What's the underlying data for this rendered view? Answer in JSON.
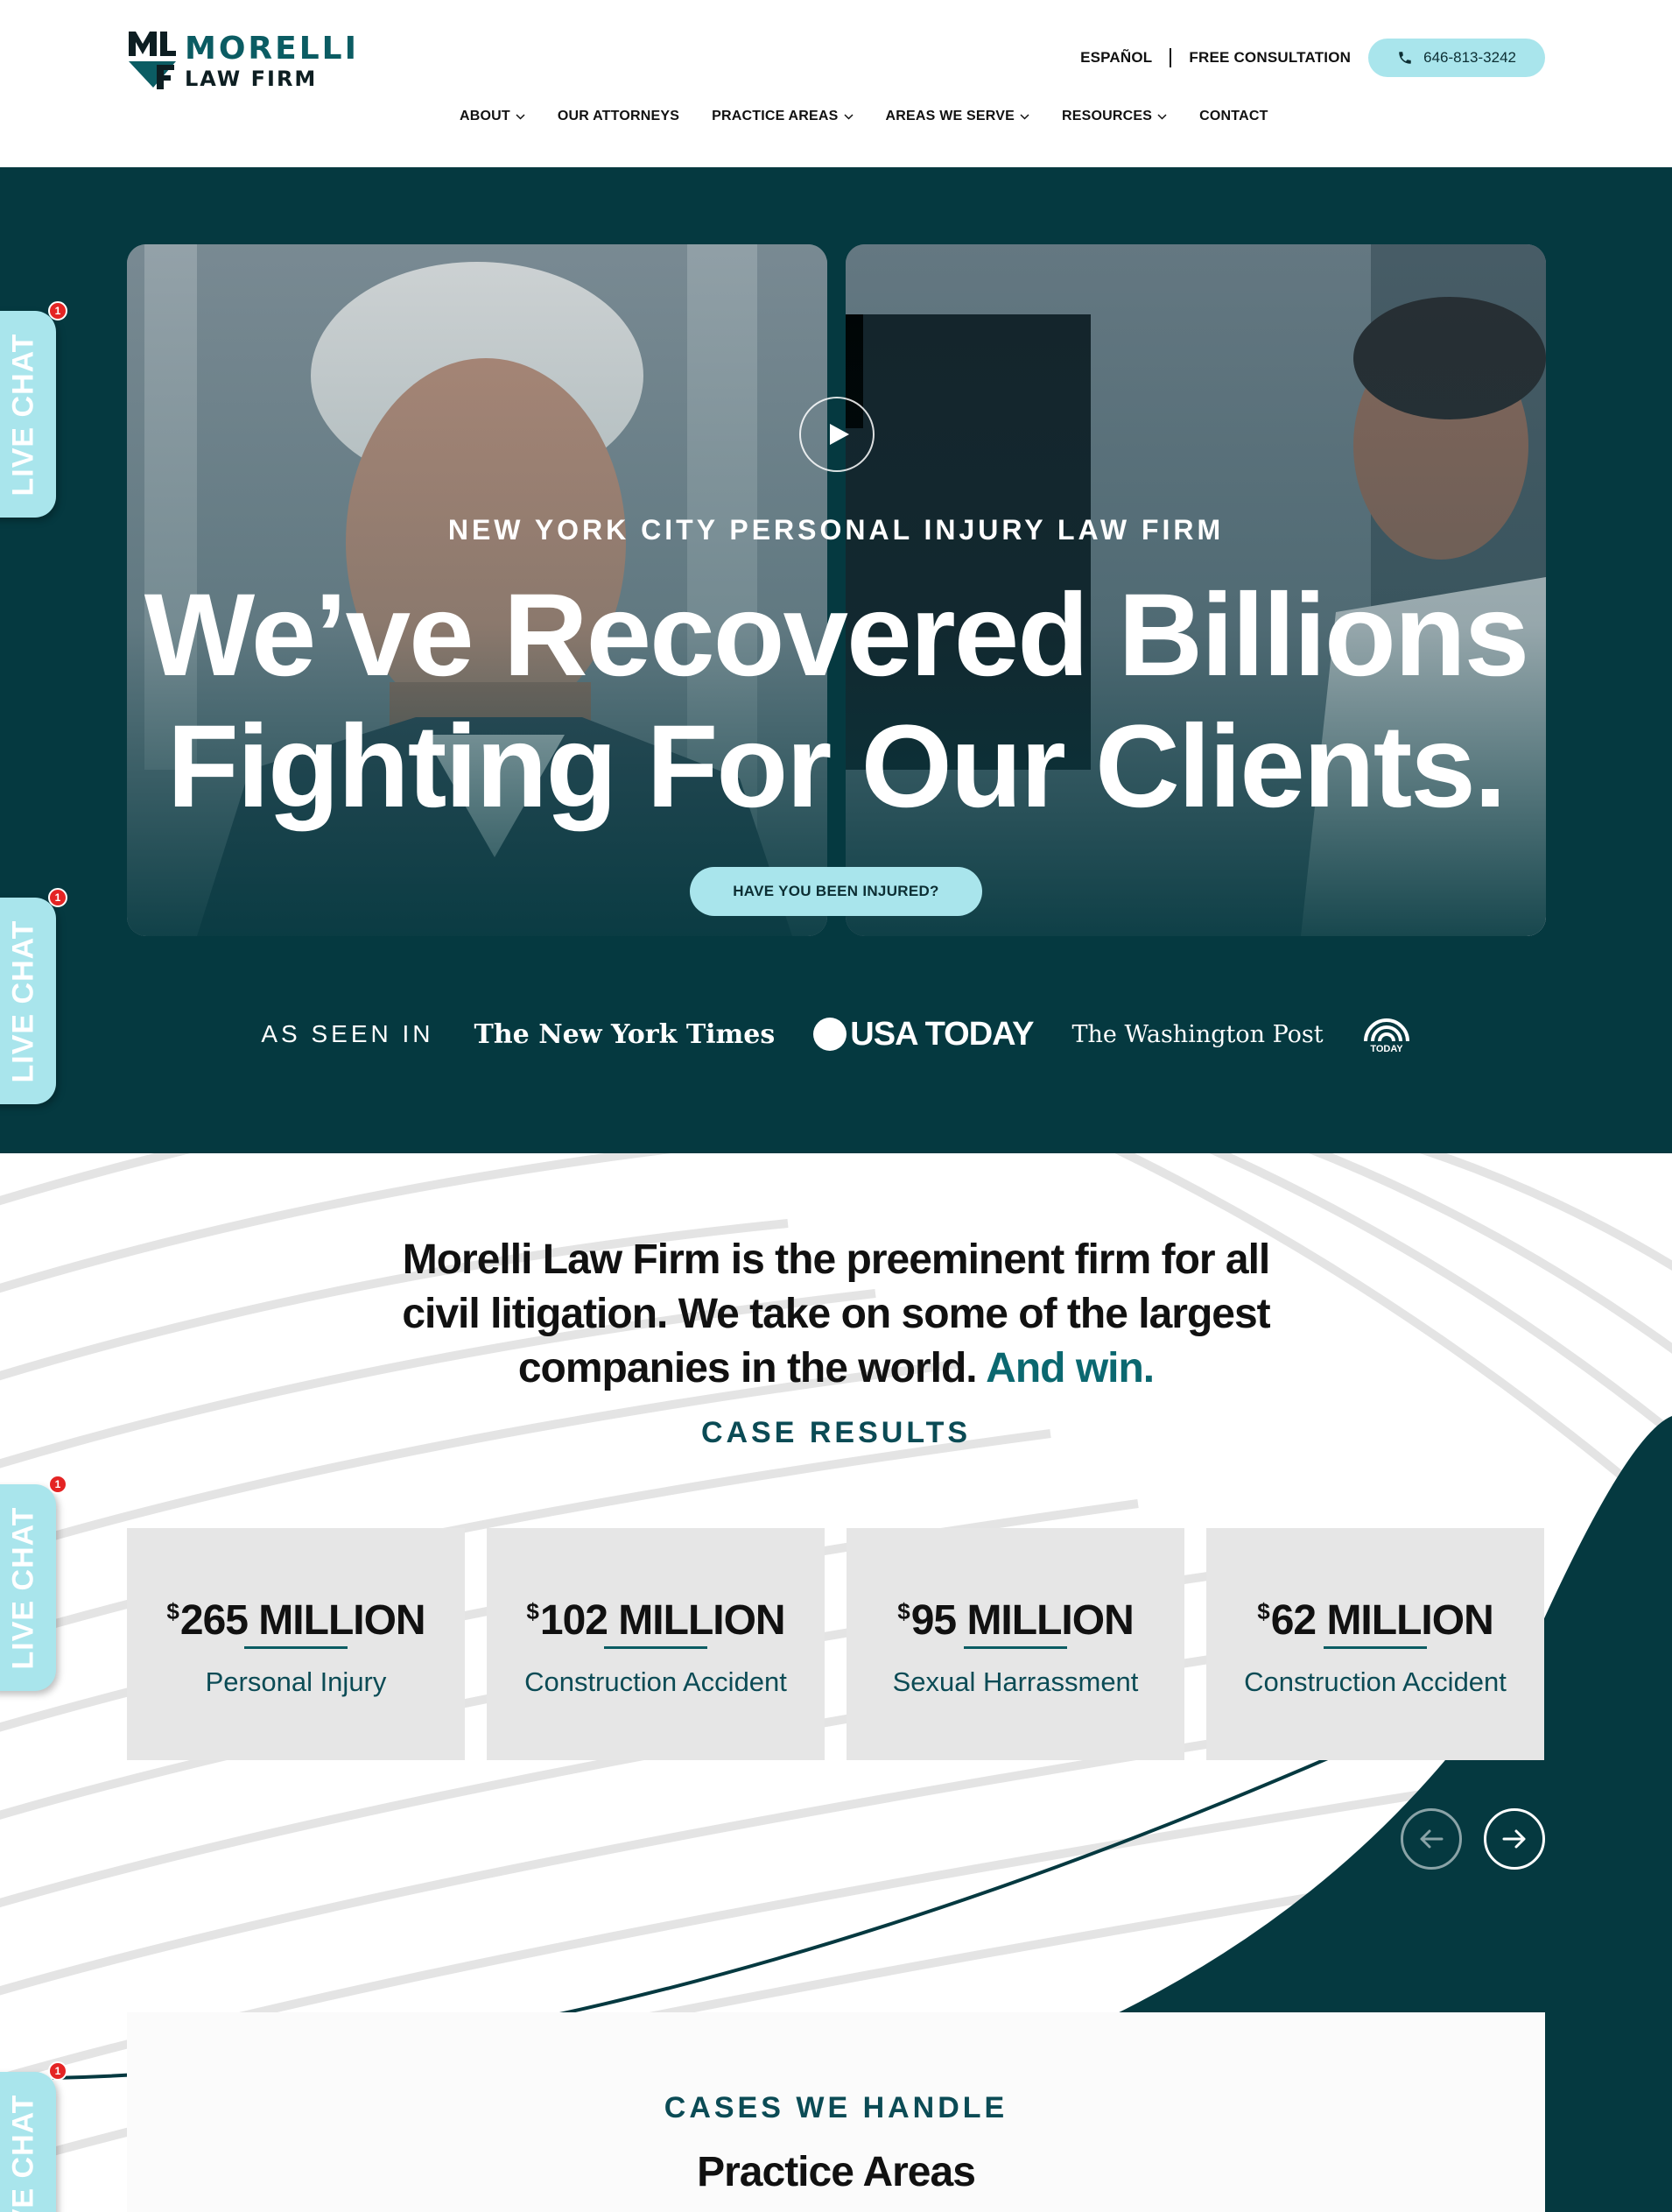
{
  "brand": {
    "name": "MORELLI",
    "sub": "LAW FIRM",
    "mark": "MLF"
  },
  "utility": {
    "espanol": "ESPAÑOL",
    "free_consultation": "FREE CONSULTATION",
    "phone": "646-813-3242"
  },
  "nav": [
    {
      "label": "ABOUT",
      "dropdown": true
    },
    {
      "label": "OUR ATTORNEYS",
      "dropdown": false
    },
    {
      "label": "PRACTICE AREAS",
      "dropdown": true
    },
    {
      "label": "AREAS WE SERVE",
      "dropdown": true
    },
    {
      "label": "RESOURCES",
      "dropdown": true
    },
    {
      "label": "CONTACT",
      "dropdown": false
    }
  ],
  "hero": {
    "kicker": "NEW YORK CITY PERSONAL INJURY LAW FIRM",
    "headline_part1": "We’ve Recovered ",
    "headline_bold": "Billions",
    "headline_line2": "Fighting For Our Clients.",
    "cta": "HAVE YOU BEEN INJURED?",
    "seen_in_label": "AS SEEN IN",
    "press": {
      "nyt": "The New York Times",
      "usa_today": "USA TODAY",
      "wapo": "The Washington Post",
      "today": "TODAY"
    }
  },
  "intro": {
    "line1": "Morelli Law Firm is the preeminent firm for all",
    "line2": "civil litigation. We take on some of the largest",
    "line3": "companies in the world. ",
    "accent": "And win."
  },
  "case_results": {
    "kicker": "CASE RESULTS",
    "cards": [
      {
        "currency": "$",
        "amount": "265 MILLION",
        "label": "Personal Injury"
      },
      {
        "currency": "$",
        "amount": "102 MILLION",
        "label": "Construction Accident"
      },
      {
        "currency": "$",
        "amount": "95 MILLION",
        "label": "Sexual Harrassment"
      },
      {
        "currency": "$",
        "amount": "62 MILLION",
        "label": "Construction Accident"
      }
    ]
  },
  "practice": {
    "kicker": "CASES WE HANDLE",
    "title": "Practice Areas"
  },
  "live_chat": {
    "label": "LIVE CHAT",
    "badge": "1"
  },
  "colors": {
    "teal_dark": "#053940",
    "accent_light": "#a9e5ec",
    "brand_teal": "#0b5c63"
  }
}
